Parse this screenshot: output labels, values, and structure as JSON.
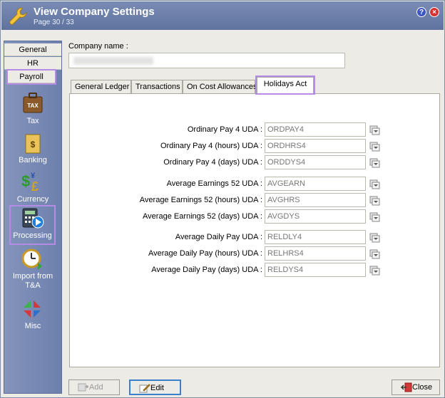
{
  "window": {
    "title": "View Company Settings",
    "subtitle": "Page 30 / 33",
    "help_label": "?",
    "close_label": "×"
  },
  "sidebar": {
    "tabs": [
      "General",
      "HR",
      "Payroll"
    ],
    "items": [
      {
        "label": "Tax",
        "icon": "tax-icon"
      },
      {
        "label": "Banking",
        "icon": "banking-icon"
      },
      {
        "label": "Currency",
        "icon": "currency-icon"
      },
      {
        "label": "Processing",
        "icon": "processing-icon"
      },
      {
        "label": "Import from T&A",
        "icon": "import-clock-icon"
      },
      {
        "label": "Misc",
        "icon": "misc-icon"
      }
    ]
  },
  "company": {
    "label": "Company name :"
  },
  "tabs": [
    "General Ledger",
    "Transactions",
    "On Cost Allowances",
    "Holidays Act"
  ],
  "rows": [
    {
      "label": "Ordinary Pay 4 UDA :",
      "value": "ORDPAY4"
    },
    {
      "label": "Ordinary Pay 4 (hours) UDA :",
      "value": "ORDHRS4"
    },
    {
      "label": "Ordinary Pay 4 (days) UDA :",
      "value": "ORDDYS4"
    },
    {
      "label": "Average Earnings 52 UDA :",
      "value": "AVGEARN"
    },
    {
      "label": "Average Earnings 52 (hours) UDA :",
      "value": "AVGHRS"
    },
    {
      "label": "Average Earnings 52 (days) UDA :",
      "value": "AVGDYS"
    },
    {
      "label": "Average Daily Pay UDA :",
      "value": "RELDLY4"
    },
    {
      "label": "Average Daily Pay (hours) UDA :",
      "value": "RELHRS4"
    },
    {
      "label": "Average Daily Pay (days) UDA :",
      "value": "RELDYS4"
    }
  ],
  "buttons": {
    "add": "Add",
    "edit": "Edit",
    "close": "Close"
  }
}
